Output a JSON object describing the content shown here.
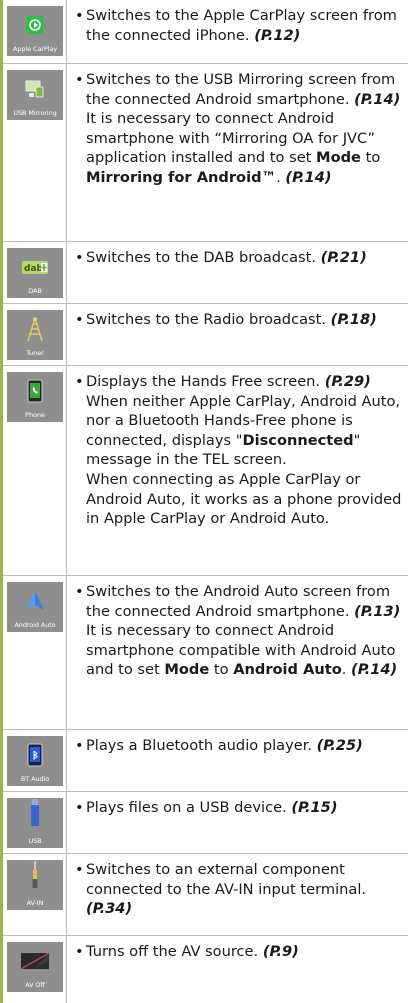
{
  "rows": [
    {
      "icon": {
        "name": "apple-carplay-icon",
        "caption": "Apple CarPlay"
      },
      "text": "Switches to the Apple CarPlay screen from the connected iPhone.",
      "ref": "(P.12)"
    },
    {
      "icon": {
        "name": "usb-mirroring-icon",
        "caption": "USB Mirroring"
      },
      "text": "Switches to the USB Mirroring screen from the connected Android smartphone.",
      "ref": "(P.14)",
      "note_pre": "It is necessary to connect Android smartphone with “Mirroring OA for JVC” application installed and to set",
      "note_strong1": "Mode",
      "note_mid": "to",
      "note_strong2": "Mirroring for Android™",
      "note_sep": ".",
      "note_ref": "(P.14)"
    },
    {
      "icon": {
        "name": "dab-icon",
        "caption": "DAB",
        "badge": "dab"
      },
      "text": "Switches to the DAB broadcast.",
      "ref": "(P.21)"
    },
    {
      "icon": {
        "name": "tuner-antenna-icon",
        "caption": "Tuner"
      },
      "text": "Switches to the Radio broadcast.",
      "ref": "(P.18)"
    },
    {
      "icon": {
        "name": "phone-icon",
        "caption": "Phone"
      },
      "text": "Displays the Hands Free screen.",
      "ref": "(P.29)",
      "note_pre": "When neither Apple CarPlay, Android Auto, nor a Bluetooth Hands-Free phone is connected, displays \"",
      "note_strong1": "Disconnected",
      "note_post": "\" message in the TEL screen.",
      "note2": "When connecting as Apple CarPlay or Android Auto, it works as a phone provided in Apple CarPlay or Android Auto."
    },
    {
      "icon": {
        "name": "android-auto-icon",
        "caption": "Android Auto"
      },
      "text": "Switches to the Android Auto screen from the connected Android smartphone.",
      "ref": "(P.13)",
      "note_pre": "It is necessary to connect Android smartphone compatible with Android Auto and to set",
      "note_strong1": "Mode",
      "note_mid": "to",
      "note_strong2": "Android Auto",
      "note_sep": ".",
      "note_ref": "(P.14)"
    },
    {
      "icon": {
        "name": "bluetooth-audio-icon",
        "caption": "BT Audio"
      },
      "text": "Plays a Bluetooth audio player.",
      "ref": "(P.25)"
    },
    {
      "icon": {
        "name": "usb-icon",
        "caption": "USB"
      },
      "text": "Plays files on a USB device.",
      "ref": "(P.15)"
    },
    {
      "icon": {
        "name": "av-in-icon",
        "caption": "AV-IN"
      },
      "text": "Switches to an external component connected to the AV-IN input terminal.",
      "ref": "(P.34)"
    },
    {
      "icon": {
        "name": "av-off-icon",
        "caption": "AV Off"
      },
      "text": "Turns off the AV source.",
      "ref": "(P.9)"
    }
  ],
  "bullet": "•",
  "colors": {
    "gutter": "#9ab64a",
    "icon_bg": "#8e8e8e",
    "rule": "#bdbdbd"
  }
}
